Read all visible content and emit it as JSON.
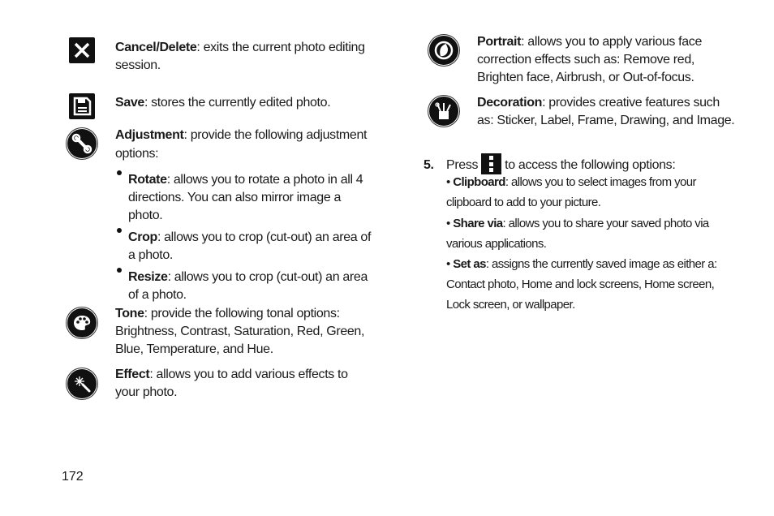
{
  "left_column": {
    "items": [
      {
        "icon": "close-icon",
        "term": "Cancel/Delete",
        "desc": ": exits the current photo editing session."
      },
      {
        "icon": "save-disk-icon",
        "term": "Save",
        "desc": ": stores the currently edited photo."
      },
      {
        "icon": "wrench-icon",
        "term": "Adjustment",
        "desc": ": provide the following adjustment options:"
      },
      {
        "icon": "palette-icon",
        "term": "Tone",
        "desc": ": provide the following tonal options: Brightness, Contrast, Saturation, Red, Green, Blue, Temperature, and Hue."
      },
      {
        "icon": "magic-wand-icon",
        "term": "Effect",
        "desc": ": allows you to add various effects to your photo."
      }
    ],
    "adjustment_options": [
      {
        "term": "Rotate",
        "desc": ": allows you to rotate a photo in all 4 directions. You can also mirror image a photo."
      },
      {
        "term": "Crop",
        "desc": ": allows you to crop (cut-out) an area of a photo."
      },
      {
        "term": "Resize",
        "desc": ": allows you to crop (cut-out) an area of a photo."
      }
    ]
  },
  "right_column": {
    "items": [
      {
        "icon": "portrait-icon",
        "term": "Portrait",
        "desc": ": allows you to apply various face correction effects such as: Remove red, Brighten face, Airbrush, or Out-of-focus."
      },
      {
        "icon": "decoration-icon",
        "term": "Decoration",
        "desc": ": provides creative features such as: Sticker, Label, Frame, Drawing, and Image."
      }
    ],
    "step": {
      "number": "5.",
      "before": "Press",
      "after": "to access the following options:",
      "key_icon": "menu-key-icon"
    },
    "options": [
      {
        "term": "Clipboard",
        "desc": ": allows you to select images from your clipboard to add to your picture."
      },
      {
        "term": "Share via",
        "desc": ": allows you to share your saved photo via various applications."
      },
      {
        "term": "Set as",
        "desc": ": assigns the currently saved image as either a: Contact photo, Home and lock screens, Home screen, Lock screen, or wallpaper."
      }
    ]
  },
  "page_number": "172"
}
